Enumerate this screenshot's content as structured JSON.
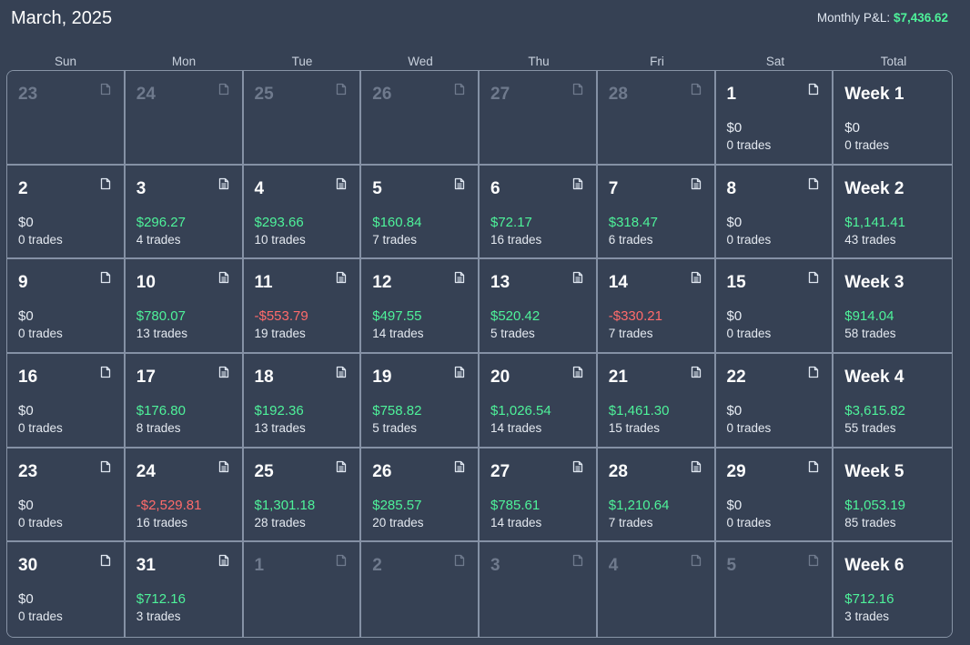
{
  "header": {
    "month_title": "March, 2025",
    "monthly_pl_label": "Monthly P&L:",
    "monthly_pl_value": "$7,436.62"
  },
  "colors": {
    "background": "#364154",
    "positive": "#4ef29a",
    "negative": "#ff6b6b",
    "grid_line": "#8591a5",
    "muted_text": "#6f7a8d"
  },
  "columns": [
    "Sun",
    "Mon",
    "Tue",
    "Wed",
    "Thu",
    "Fri",
    "Sat",
    "Total"
  ],
  "weeks": [
    {
      "days": [
        {
          "day": "23",
          "in_month": false,
          "icon": "file-icon"
        },
        {
          "day": "24",
          "in_month": false,
          "icon": "file-icon"
        },
        {
          "day": "25",
          "in_month": false,
          "icon": "file-icon"
        },
        {
          "day": "26",
          "in_month": false,
          "icon": "file-icon"
        },
        {
          "day": "27",
          "in_month": false,
          "icon": "file-icon"
        },
        {
          "day": "28",
          "in_month": false,
          "icon": "file-icon"
        },
        {
          "day": "1",
          "in_month": true,
          "icon": "file-icon",
          "pnl": "$0",
          "sign": "zero",
          "trades": "0 trades"
        }
      ],
      "total": {
        "label": "Week 1",
        "pnl": "$0",
        "sign": "zero",
        "trades": "0 trades"
      }
    },
    {
      "days": [
        {
          "day": "2",
          "in_month": true,
          "icon": "file-icon",
          "pnl": "$0",
          "sign": "zero",
          "trades": "0 trades"
        },
        {
          "day": "3",
          "in_month": true,
          "icon": "file-text-icon",
          "pnl": "$296.27",
          "sign": "pos",
          "trades": "4 trades"
        },
        {
          "day": "4",
          "in_month": true,
          "icon": "file-text-icon",
          "pnl": "$293.66",
          "sign": "pos",
          "trades": "10 trades"
        },
        {
          "day": "5",
          "in_month": true,
          "icon": "file-text-icon",
          "pnl": "$160.84",
          "sign": "pos",
          "trades": "7 trades"
        },
        {
          "day": "6",
          "in_month": true,
          "icon": "file-text-icon",
          "pnl": "$72.17",
          "sign": "pos",
          "trades": "16 trades"
        },
        {
          "day": "7",
          "in_month": true,
          "icon": "file-text-icon",
          "pnl": "$318.47",
          "sign": "pos",
          "trades": "6 trades"
        },
        {
          "day": "8",
          "in_month": true,
          "icon": "file-icon",
          "pnl": "$0",
          "sign": "zero",
          "trades": "0 trades"
        }
      ],
      "total": {
        "label": "Week 2",
        "pnl": "$1,141.41",
        "sign": "pos",
        "trades": "43 trades"
      }
    },
    {
      "days": [
        {
          "day": "9",
          "in_month": true,
          "icon": "file-icon",
          "pnl": "$0",
          "sign": "zero",
          "trades": "0 trades"
        },
        {
          "day": "10",
          "in_month": true,
          "icon": "file-text-icon",
          "pnl": "$780.07",
          "sign": "pos",
          "trades": "13 trades"
        },
        {
          "day": "11",
          "in_month": true,
          "icon": "file-text-icon",
          "pnl": "-$553.79",
          "sign": "neg",
          "trades": "19 trades"
        },
        {
          "day": "12",
          "in_month": true,
          "icon": "file-text-icon",
          "pnl": "$497.55",
          "sign": "pos",
          "trades": "14 trades"
        },
        {
          "day": "13",
          "in_month": true,
          "icon": "file-text-icon",
          "pnl": "$520.42",
          "sign": "pos",
          "trades": "5 trades"
        },
        {
          "day": "14",
          "in_month": true,
          "icon": "file-text-icon",
          "pnl": "-$330.21",
          "sign": "neg",
          "trades": "7 trades"
        },
        {
          "day": "15",
          "in_month": true,
          "icon": "file-icon",
          "pnl": "$0",
          "sign": "zero",
          "trades": "0 trades"
        }
      ],
      "total": {
        "label": "Week 3",
        "pnl": "$914.04",
        "sign": "pos",
        "trades": "58 trades"
      }
    },
    {
      "days": [
        {
          "day": "16",
          "in_month": true,
          "icon": "file-icon",
          "pnl": "$0",
          "sign": "zero",
          "trades": "0 trades"
        },
        {
          "day": "17",
          "in_month": true,
          "icon": "file-text-icon",
          "pnl": "$176.80",
          "sign": "pos",
          "trades": "8 trades"
        },
        {
          "day": "18",
          "in_month": true,
          "icon": "file-text-icon",
          "pnl": "$192.36",
          "sign": "pos",
          "trades": "13 trades"
        },
        {
          "day": "19",
          "in_month": true,
          "icon": "file-text-icon",
          "pnl": "$758.82",
          "sign": "pos",
          "trades": "5 trades"
        },
        {
          "day": "20",
          "in_month": true,
          "icon": "file-text-icon",
          "pnl": "$1,026.54",
          "sign": "pos",
          "trades": "14 trades"
        },
        {
          "day": "21",
          "in_month": true,
          "icon": "file-text-icon",
          "pnl": "$1,461.30",
          "sign": "pos",
          "trades": "15 trades"
        },
        {
          "day": "22",
          "in_month": true,
          "icon": "file-icon",
          "pnl": "$0",
          "sign": "zero",
          "trades": "0 trades"
        }
      ],
      "total": {
        "label": "Week 4",
        "pnl": "$3,615.82",
        "sign": "pos",
        "trades": "55 trades"
      }
    },
    {
      "days": [
        {
          "day": "23",
          "in_month": true,
          "icon": "file-icon",
          "pnl": "$0",
          "sign": "zero",
          "trades": "0 trades"
        },
        {
          "day": "24",
          "in_month": true,
          "icon": "file-text-icon",
          "pnl": "-$2,529.81",
          "sign": "neg",
          "trades": "16 trades"
        },
        {
          "day": "25",
          "in_month": true,
          "icon": "file-text-icon",
          "pnl": "$1,301.18",
          "sign": "pos",
          "trades": "28 trades"
        },
        {
          "day": "26",
          "in_month": true,
          "icon": "file-text-icon",
          "pnl": "$285.57",
          "sign": "pos",
          "trades": "20 trades"
        },
        {
          "day": "27",
          "in_month": true,
          "icon": "file-text-icon",
          "pnl": "$785.61",
          "sign": "pos",
          "trades": "14 trades"
        },
        {
          "day": "28",
          "in_month": true,
          "icon": "file-text-icon",
          "pnl": "$1,210.64",
          "sign": "pos",
          "trades": "7 trades"
        },
        {
          "day": "29",
          "in_month": true,
          "icon": "file-icon",
          "pnl": "$0",
          "sign": "zero",
          "trades": "0 trades"
        }
      ],
      "total": {
        "label": "Week 5",
        "pnl": "$1,053.19",
        "sign": "pos",
        "trades": "85 trades"
      }
    },
    {
      "days": [
        {
          "day": "30",
          "in_month": true,
          "icon": "file-icon",
          "pnl": "$0",
          "sign": "zero",
          "trades": "0 trades"
        },
        {
          "day": "31",
          "in_month": true,
          "icon": "file-text-icon",
          "pnl": "$712.16",
          "sign": "pos",
          "trades": "3 trades"
        },
        {
          "day": "1",
          "in_month": false,
          "icon": "file-icon"
        },
        {
          "day": "2",
          "in_month": false,
          "icon": "file-icon"
        },
        {
          "day": "3",
          "in_month": false,
          "icon": "file-icon"
        },
        {
          "day": "4",
          "in_month": false,
          "icon": "file-icon"
        },
        {
          "day": "5",
          "in_month": false,
          "icon": "file-icon"
        }
      ],
      "total": {
        "label": "Week 6",
        "pnl": "$712.16",
        "sign": "pos",
        "trades": "3 trades"
      }
    }
  ]
}
